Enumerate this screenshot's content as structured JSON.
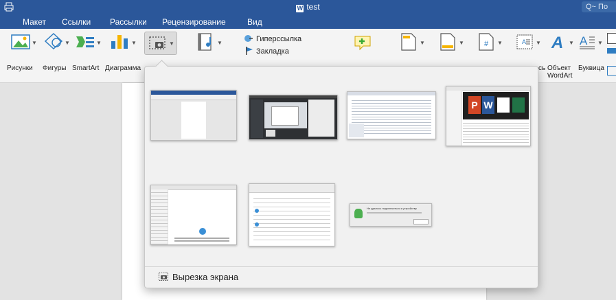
{
  "window": {
    "title": "test",
    "search_placeholder": "Q~ По"
  },
  "tabs": [
    "Макет",
    "Ссылки",
    "Рассылки",
    "Рецензирование",
    "Вид"
  ],
  "ribbon": {
    "buttons": {
      "pictures": "Рисунки",
      "shapes": "Фигуры",
      "smartart": "SmartArt",
      "chart": "Диаграмма",
      "hyperlink": "Гиперссылка",
      "bookmark": "Закладка",
      "textbox_partial": "сь",
      "wordart_line1": "Объект",
      "wordart_line2": "WordArt",
      "dropcap": "Буквица"
    }
  },
  "screenshot_menu": {
    "footer_label": "Вырезка экрана",
    "thumbnail_count": 7,
    "dialog_thumb_text": "Не удалось подключиться к устройству"
  },
  "colors": {
    "brand": "#2b579a",
    "ribbon": "#f4f4f4"
  }
}
